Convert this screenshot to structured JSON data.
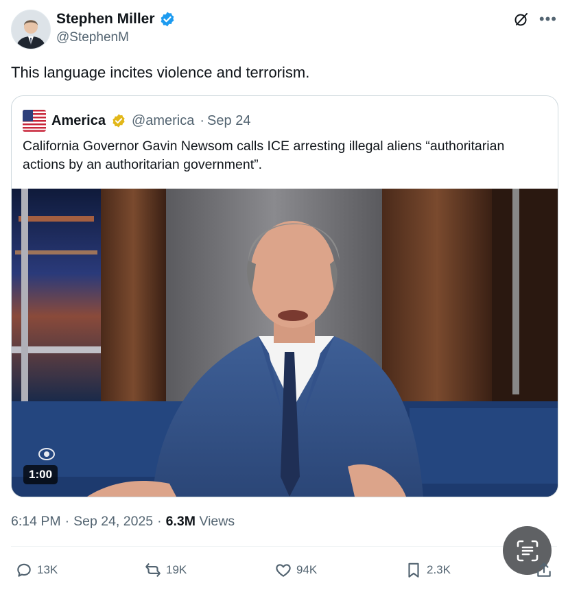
{
  "author": {
    "name": "Stephen Miller",
    "handle": "@StephenM",
    "verified": "blue-check-icon"
  },
  "tweet_text": "This language incites violence and terrorism.",
  "quoted": {
    "name": "America",
    "verified": "gold-check-icon",
    "handle": "@america",
    "separator": "·",
    "date": "Sep 24",
    "text": "California Governor Gavin Newsom calls ICE arresting illegal aliens “authoritarian actions by an authoritarian government”.",
    "video": {
      "duration": "1:00"
    }
  },
  "meta": {
    "time": "6:14 PM",
    "sep1": "·",
    "date": "Sep 24, 2025",
    "sep2": "·",
    "views": "6.3M",
    "views_label": "Views"
  },
  "actions": {
    "replies": "13K",
    "reposts": "19K",
    "likes": "94K",
    "bookmarks": "2.3K"
  },
  "colors": {
    "verified_blue": "#1d9bf0",
    "verified_gold": "#e2b719",
    "muted": "#536471",
    "border": "#cfd9de"
  }
}
